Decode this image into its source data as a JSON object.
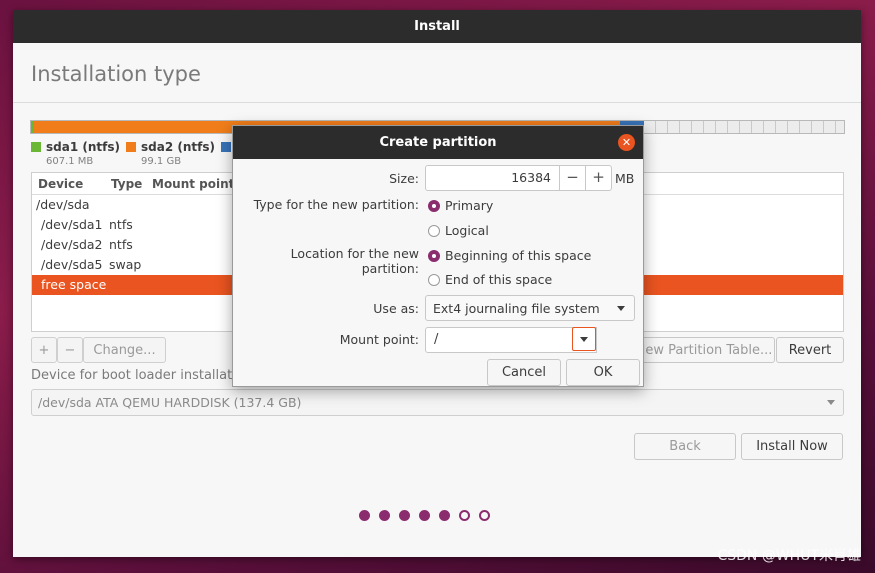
{
  "window": {
    "title": "Install"
  },
  "page": {
    "title": "Installation type"
  },
  "partition_bar": {
    "segments": [
      {
        "name": "sda1",
        "fraction": 0.004,
        "color": "#6ab635"
      },
      {
        "name": "sda2",
        "fraction": 0.72,
        "color": "#f07d1a"
      },
      {
        "name": "sda5",
        "fraction": 0.03,
        "color": "#3873b8"
      },
      {
        "name": "free space",
        "fraction": 0.246,
        "color": "#ececec"
      }
    ]
  },
  "legend": [
    {
      "label": "sda1 (ntfs)",
      "size": "607.1 MB",
      "color": "#6ab635"
    },
    {
      "label": "sda2 (ntfs)",
      "size": "99.1 GB",
      "color": "#f07d1a"
    },
    {
      "label": "",
      "size": "",
      "color": "#3873b8"
    }
  ],
  "table": {
    "columns": [
      "Device",
      "Type",
      "Mount point"
    ],
    "rows": [
      {
        "device": "/dev/sda",
        "type": ""
      },
      {
        "device": "/dev/sda1",
        "type": "ntfs"
      },
      {
        "device": "/dev/sda2",
        "type": "ntfs"
      },
      {
        "device": "/dev/sda5",
        "type": "swap"
      },
      {
        "device": "free space",
        "type": ""
      }
    ]
  },
  "table_buttons": {
    "add": "+",
    "remove": "−",
    "change": "Change...",
    "new_table": "New Partition Table...",
    "revert": "Revert"
  },
  "boot_loader": {
    "label": "Device for boot loader installation:",
    "value": "/dev/sda   ATA QEMU HARDDISK (137.4 GB)"
  },
  "nav": {
    "back": "Back",
    "install_now": "Install Now"
  },
  "progress": {
    "steps_total": 7,
    "steps_done": 5
  },
  "watermark": "CSDN @WHUT米肖雄",
  "dialog": {
    "title": "Create partition",
    "size_label": "Size:",
    "size_value": "16384",
    "size_unit": "MB",
    "minus": "−",
    "plus": "+",
    "type_label": "Type for the new partition:",
    "type_options": [
      "Primary",
      "Logical"
    ],
    "type_selected": "Primary",
    "location_label": "Location for the new partition:",
    "location_options": [
      "Beginning of this space",
      "End of this space"
    ],
    "location_selected": "Beginning of this space",
    "use_as_label": "Use as:",
    "use_as_value": "Ext4 journaling file system",
    "mount_label": "Mount point:",
    "mount_value": "/",
    "cancel": "Cancel",
    "ok": "OK",
    "close_glyph": "✕"
  },
  "colors": {
    "accent": "#e95420",
    "aubergine": "#8a2c6e",
    "titlebar": "#2c2c2c"
  }
}
